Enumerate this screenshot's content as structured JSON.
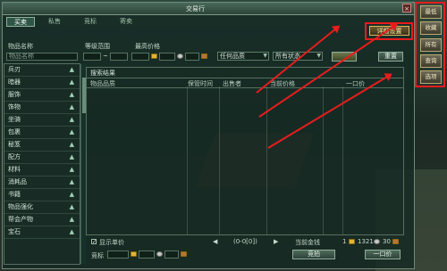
{
  "window": {
    "title": "交易行",
    "close": "×"
  },
  "tabs": [
    "买卖",
    "私售",
    "竞标",
    "寄卖"
  ],
  "detail_settings": "详细设置",
  "search": {
    "item_name_label": "物品名称",
    "item_name_placeholder": "物品名称",
    "level_label": "等级范围",
    "price_label": "最高价格",
    "dash": "~",
    "quality": "任何品质",
    "status": "所有状态",
    "search_button": "",
    "reset_button": "重置"
  },
  "categories": [
    "兵刃",
    "暗器",
    "服饰",
    "饰物",
    "坐骑",
    "包裹",
    "秘笈",
    "配方",
    "材料",
    "消耗品",
    "书籍",
    "物品强化",
    "帮会产物",
    "宝石"
  ],
  "results": {
    "title": "搜索结果",
    "columns": [
      "物品品质",
      "保管时间",
      "出售者",
      "当前价格",
      "一口价"
    ]
  },
  "bottom": {
    "show_unit_price": "显示单价",
    "paging": "(0-0[0])",
    "money_label": "当前金钱",
    "money_gold": "1",
    "money_silver": "1321",
    "money_copper": "30",
    "bid_label": "竞标",
    "bid_button": "竞拍",
    "buyout_button": "一口价"
  },
  "side_buttons": [
    "最低",
    "收藏",
    "所有",
    "查询",
    "选项"
  ],
  "colors": {
    "highlight": "#e81c1c",
    "panel": "#1c342c",
    "gold": "#e2b436"
  }
}
